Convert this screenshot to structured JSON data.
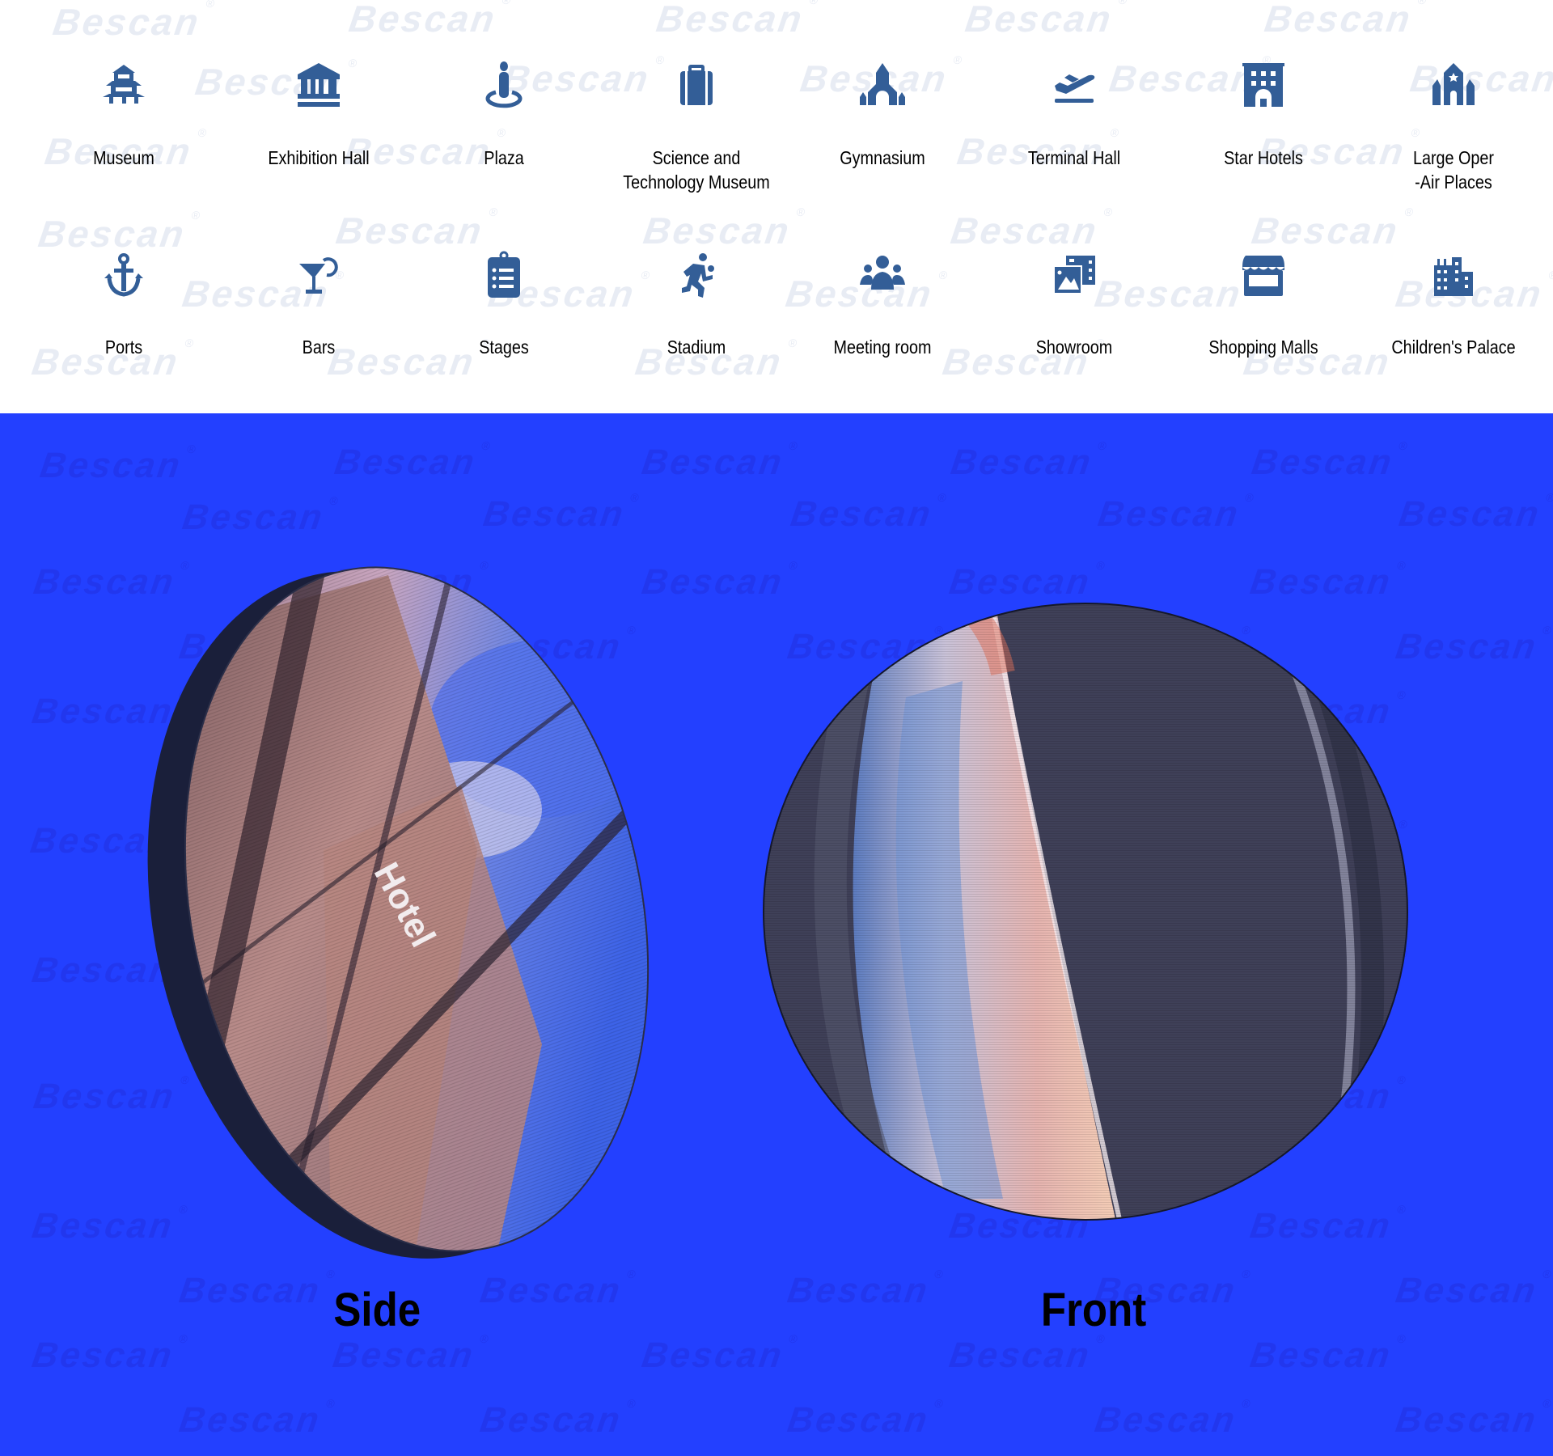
{
  "watermark": {
    "text": "Bescan",
    "mark": "®"
  },
  "colors": {
    "icon": "#335E97",
    "background_top": "#FFFFFF",
    "background_bottom": "#2340FF",
    "watermark": "#E8ECF4",
    "rim": "#1A1F3A"
  },
  "features": {
    "row1": [
      {
        "label": "Museum",
        "icon": "pagoda-icon"
      },
      {
        "label": "Exhibition Hall",
        "icon": "columns-building-icon"
      },
      {
        "label": "Plaza",
        "icon": "person-pin-icon"
      },
      {
        "label": "Science and\nTechnology Museum",
        "icon": "briefcase-icon"
      },
      {
        "label": "Gymnasium",
        "icon": "church-icon"
      },
      {
        "label": "Terminal Hall",
        "icon": "airplane-departure-icon"
      },
      {
        "label": "Star Hotels",
        "icon": "hotel-icon"
      },
      {
        "label": "Large Oper\n-Air Places",
        "icon": "synagogue-icon"
      }
    ],
    "row2": [
      {
        "label": "Ports",
        "icon": "anchor-icon"
      },
      {
        "label": "Bars",
        "icon": "cocktail-icon"
      },
      {
        "label": "Stages",
        "icon": "clipboard-list-icon"
      },
      {
        "label": "Stadium",
        "icon": "running-person-icon"
      },
      {
        "label": "Meeting room",
        "icon": "users-icon"
      },
      {
        "label": "Showroom",
        "icon": "photo-gallery-icon"
      },
      {
        "label": "Shopping Malls",
        "icon": "storefront-icon"
      },
      {
        "label": "Children's Palace",
        "icon": "city-buildings-icon"
      }
    ]
  },
  "views": {
    "side": {
      "caption": "Side",
      "screen_text": "Hotel"
    },
    "front": {
      "caption": "Front"
    }
  }
}
